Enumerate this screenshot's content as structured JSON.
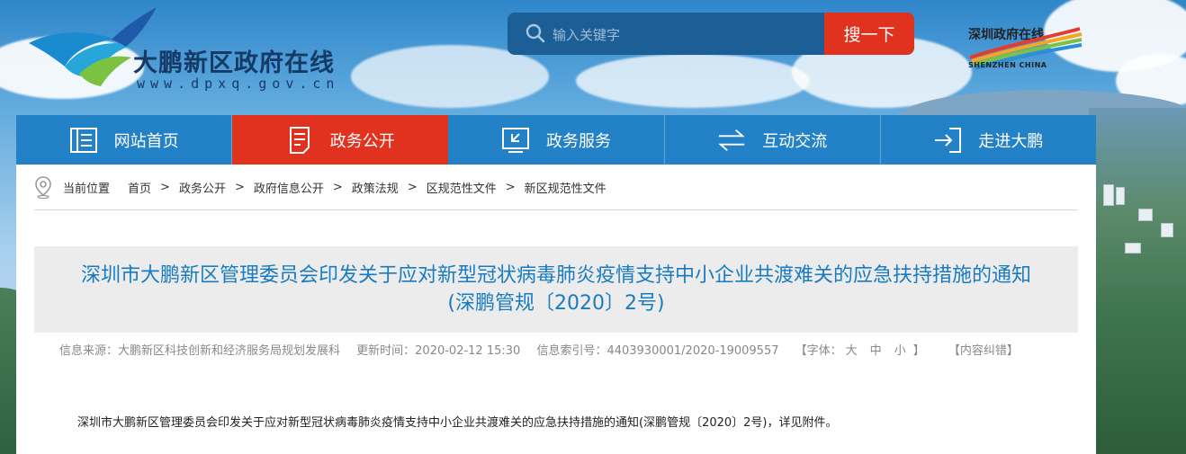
{
  "header": {
    "site_title": "大鹏新区政府在线",
    "site_url": "www.dpxq.gov.cn",
    "brand_right_cn": "深圳政府在线",
    "brand_right_en": "SHENZHEN CHINA"
  },
  "search": {
    "placeholder": "输入关键字",
    "button_label": "搜一下"
  },
  "nav": {
    "items": [
      {
        "label": "网站首页",
        "icon": "home-icon"
      },
      {
        "label": "政务公开",
        "icon": "document-icon"
      },
      {
        "label": "政务服务",
        "icon": "service-icon"
      },
      {
        "label": "互动交流",
        "icon": "exchange-icon"
      },
      {
        "label": "走进大鹏",
        "icon": "enter-icon"
      }
    ],
    "active_index": 1
  },
  "breadcrumb": {
    "label": "当前位置",
    "items": [
      "首页",
      "政务公开",
      "政府信息公开",
      "政策法规",
      "区规范性文件",
      "新区规范性文件"
    ],
    "separator": ">"
  },
  "article": {
    "title_line1": "深圳市大鹏新区管理委员会印发关于应对新型冠状病毒肺炎疫情支持中小企业共渡难关的应急扶持措施的通知",
    "title_line2": "(深鹏管规〔2020〕2号)",
    "meta": {
      "source": "信息来源：大鹏新区科技创新和经济服务局规划发展科",
      "updated": "更新时间：2020-02-12  15:30",
      "index": "信息索引号：4403930001/2020-19009557",
      "font_prefix": "【字体：",
      "font_large": "大",
      "font_medium": "中",
      "font_small": "小",
      "font_suffix": "】",
      "error_report": "【内容纠错】"
    },
    "body": "深圳市大鹏新区管理委员会印发关于应对新型冠状病毒肺炎疫情支持中小企业共渡难关的应急扶持措施的通知(深鹏管规〔2020〕2号)，详见附件。"
  },
  "colors": {
    "nav_blue": "#2382c7",
    "active_red": "#e0321e",
    "search_blue": "#1c5f97",
    "title_blue": "#1a7cc0",
    "logo_navy": "#163a66"
  }
}
